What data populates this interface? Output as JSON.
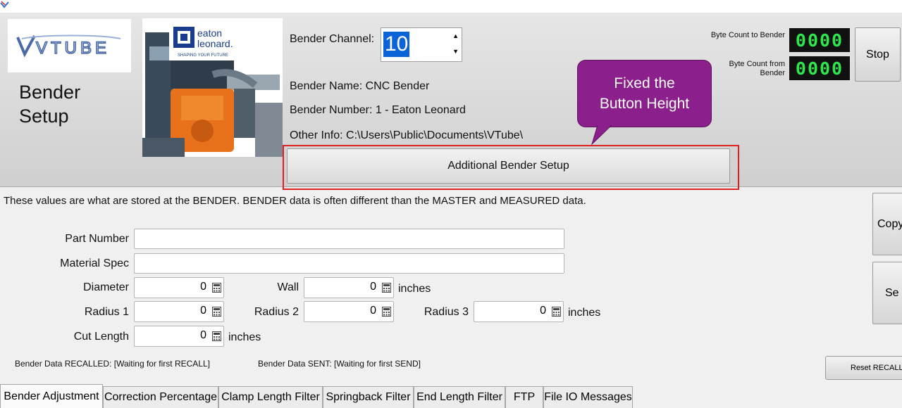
{
  "header": {
    "title": "Bender Setup",
    "logo_text": "VTUBE",
    "brand_line1": "eaton",
    "brand_line2": "leonard.",
    "brand_tagline": "SHAPING YOUR FUTURE"
  },
  "bender_info": {
    "channel_label": "Bender Channel:",
    "channel_value": "10",
    "name_label": "Bender Name: CNC Bender",
    "number_label": "Bender Number: 1 - Eaton Leonard",
    "other_info_label": "Other Info: C:\\Users\\Public\\Documents\\VTube\\"
  },
  "additional_setup_label": "Additional Bender Setup",
  "callout_text": "Fixed the Button Height",
  "byte_counts": {
    "to_label": "Byte Count to Bender",
    "to_value": "0000",
    "from_label": "Byte Count from Bender",
    "from_value": "0000"
  },
  "stop_label": "Stop",
  "info_text": "These values are what are stored at the BENDER.  BENDER data is often different than the MASTER and MEASURED data.",
  "form": {
    "part_number_label": "Part Number",
    "part_number_value": "",
    "material_spec_label": "Material Spec",
    "material_spec_value": "",
    "diameter_label": "Diameter",
    "diameter_value": "0",
    "wall_label": "Wall",
    "wall_value": "0",
    "radius1_label": "Radius 1",
    "radius1_value": "0",
    "radius2_label": "Radius 2",
    "radius2_value": "0",
    "radius3_label": "Radius 3",
    "radius3_value": "0",
    "cut_length_label": "Cut Length",
    "cut_length_value": "0",
    "unit": "inches"
  },
  "status": {
    "recalled": "Bender Data RECALLED: [Waiting for first RECALL]",
    "sent": "Bender Data SENT: [Waiting for first SEND]"
  },
  "side_buttons": {
    "copy_label": "Copy",
    "send_label": "Se",
    "reset_label": "Reset RECALL T"
  },
  "tabs": [
    {
      "label": "Bender Adjustment"
    },
    {
      "label": "Correction Percentage"
    },
    {
      "label": "Clamp Length Filter"
    },
    {
      "label": "Springback Filter"
    },
    {
      "label": "End Length Filter"
    },
    {
      "label": "FTP"
    },
    {
      "label": "File IO Messages"
    }
  ],
  "colors": {
    "callout": "#8b1f8b",
    "highlight": "#e02020",
    "led": "#2ce84a",
    "selection": "#0a64d8"
  }
}
